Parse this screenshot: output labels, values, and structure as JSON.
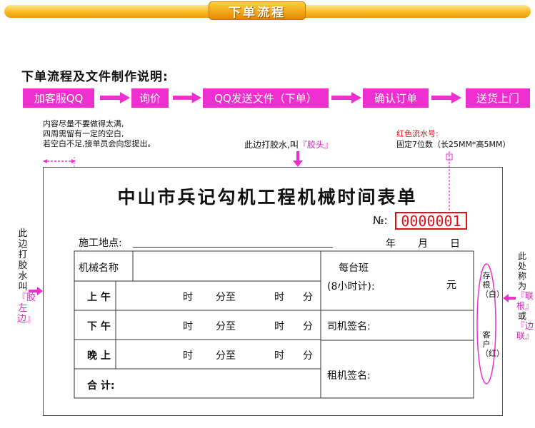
{
  "banner": {
    "title": "下单流程"
  },
  "heading": "下单流程及文件制作说明:",
  "steps": [
    "加客服QQ",
    "询价",
    "QQ发送文件（下单）",
    "确认订单",
    "送货上门"
  ],
  "notes": {
    "margin": [
      "内容尽量不要做得太满,",
      "四周需留有一定的空白,",
      "若空白不足,接单员会向您提出。"
    ],
    "glue_top_prefix": "此边打胶水,叫",
    "glue_top_name": "『胶头』",
    "serial_title": "红色流水号:",
    "serial_desc": "固定7位数（长25MM*高5MM）",
    "glue_left_prefix": "此边打胶水叫",
    "glue_left_name": "『胶左边』",
    "right_prefix": "此处称为",
    "right_name1": "『联根』",
    "right_or": "或",
    "right_name2": "『边联』"
  },
  "form": {
    "title": "中山市兵记勾机工程机械时间表单",
    "number_label": "№:",
    "number": "0000001",
    "site_label": "施工地点:",
    "date_year": "年",
    "date_month": "月",
    "date_day": "日",
    "machine_name_label": "机械名称",
    "per_shift_label": "每台班",
    "per_shift_hours": "(8小时计):",
    "yuan": "元",
    "rows": [
      {
        "label": "上 午",
        "t1": "时",
        "t2": "分至",
        "t3": "时",
        "t4": "分"
      },
      {
        "label": "下 午",
        "t1": "时",
        "t2": "分至",
        "t3": "时",
        "t4": "分"
      },
      {
        "label": "晚 上",
        "t1": "时",
        "t2": "分至",
        "t3": "时",
        "t4": "分"
      }
    ],
    "driver_sign": "司机签名:",
    "renter_sign": "租机签名:",
    "total_label": "合 计:",
    "stub_top": "存根（白）",
    "stub_bottom": "客户（红）"
  }
}
